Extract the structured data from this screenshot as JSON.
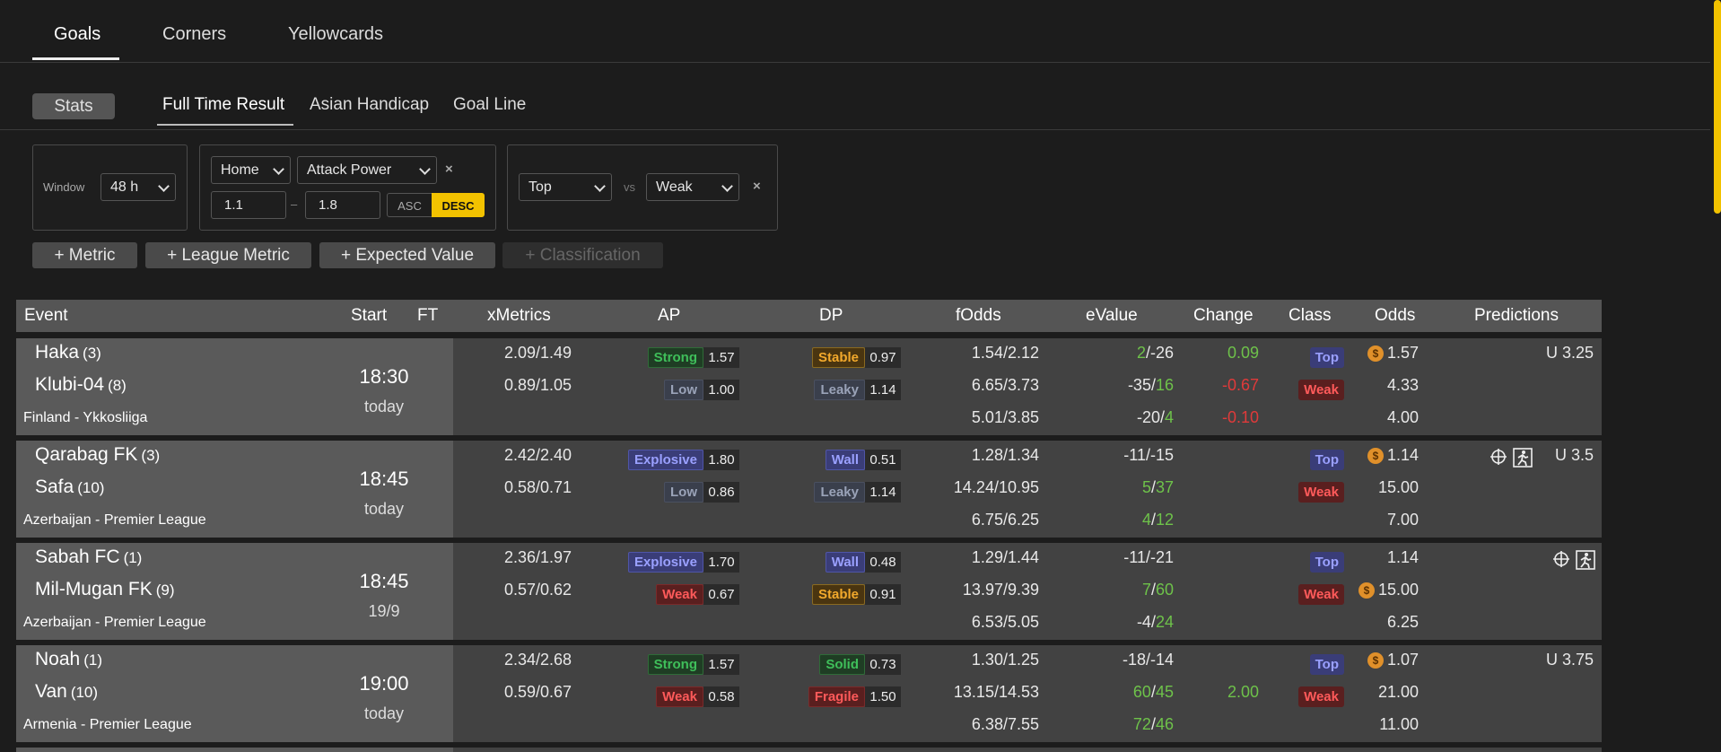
{
  "top_tabs": [
    "Goals",
    "Corners",
    "Yellowcards"
  ],
  "stats_label": "Stats",
  "sub_tabs": [
    "Full Time Result",
    "Asian Handicap",
    "Goal Line"
  ],
  "filters": {
    "window_label": "Window",
    "window_value": "48 h",
    "side_value": "Home",
    "metric_value": "Attack Power",
    "range_min": "1.1",
    "range_max": "1.8",
    "range_sep": "–",
    "asc_label": "ASC",
    "desc_label": "DESC",
    "class_a": "Top",
    "vs_label": "vs",
    "class_b": "Weak",
    "close_glyph": "×"
  },
  "add_buttons": [
    "+ Metric",
    "+ League Metric",
    "+ Expected Value",
    "+ Classification"
  ],
  "columns": [
    "Event",
    "Start",
    "FT",
    "xMetrics",
    "AP",
    "DP",
    "fOdds",
    "eValue",
    "Change",
    "Class",
    "Odds",
    "Predictions"
  ],
  "rows": [
    {
      "home": "Haka",
      "home_rank": "(3)",
      "away": "Klubi-04",
      "away_rank": "(8)",
      "league": "Finland -  Ykkosliiga",
      "time": "18:30",
      "day": "today",
      "xm": [
        "2.09/1.49",
        "0.89/1.05"
      ],
      "ap": [
        {
          "label": "Strong",
          "val": "1.57"
        },
        {
          "label": "Low",
          "val": "1.00"
        }
      ],
      "dp": [
        {
          "label": "Stable",
          "val": "0.97"
        },
        {
          "label": "Leaky",
          "val": "1.14"
        }
      ],
      "fodds": [
        "1.54/2.12",
        "6.65/3.73",
        "5.01/3.85"
      ],
      "evalue": [
        [
          "2",
          "-26"
        ],
        [
          "-35",
          "16"
        ],
        [
          "-20",
          "4"
        ]
      ],
      "change": [
        "0.09",
        "-0.67",
        "-0.10"
      ],
      "odds": [
        "1.57",
        "4.33",
        "4.00"
      ],
      "prediction": "U 3.25"
    },
    {
      "home": "Qarabag FK",
      "home_rank": "(3)",
      "away": "Safa",
      "away_rank": "(10)",
      "league": "Azerbaijan -  Premier League",
      "time": "18:45",
      "day": "today",
      "xm": [
        "2.42/2.40",
        "0.58/0.71"
      ],
      "ap": [
        {
          "label": "Explosive",
          "val": "1.80"
        },
        {
          "label": "Low",
          "val": "0.86"
        }
      ],
      "dp": [
        {
          "label": "Wall",
          "val": "0.51"
        },
        {
          "label": "Leaky",
          "val": "1.14"
        }
      ],
      "fodds": [
        "1.28/1.34",
        "14.24/10.95",
        "6.75/6.25"
      ],
      "evalue": [
        [
          "-11",
          "-15"
        ],
        [
          "5",
          "37"
        ],
        [
          "4",
          "12"
        ]
      ],
      "change": [
        "",
        "",
        ""
      ],
      "odds": [
        "1.14",
        "15.00",
        "7.00"
      ],
      "prediction": "U 3.5"
    },
    {
      "home": "Sabah FC",
      "home_rank": "(1)",
      "away": "Mil-Mugan FK",
      "away_rank": "(9)",
      "league": "Azerbaijan -  Premier League",
      "time": "18:45",
      "day": "19/9",
      "xm": [
        "2.36/1.97",
        "0.57/0.62"
      ],
      "ap": [
        {
          "label": "Explosive",
          "val": "1.70"
        },
        {
          "label": "Weak",
          "val": "0.67"
        }
      ],
      "dp": [
        {
          "label": "Wall",
          "val": "0.48"
        },
        {
          "label": "Stable",
          "val": "0.91"
        }
      ],
      "fodds": [
        "1.29/1.44",
        "13.97/9.39",
        "6.53/5.05"
      ],
      "evalue": [
        [
          "-11",
          "-21"
        ],
        [
          "7",
          "60"
        ],
        [
          "-4",
          "24"
        ]
      ],
      "change": [
        "",
        "",
        ""
      ],
      "odds": [
        "1.14",
        "15.00",
        "6.25"
      ],
      "prediction": ""
    },
    {
      "home": "Noah",
      "home_rank": "(1)",
      "away": "Van",
      "away_rank": "(10)",
      "league": "Armenia -  Premier League",
      "time": "19:00",
      "day": "today",
      "xm": [
        "2.34/2.68",
        "0.59/0.67"
      ],
      "ap": [
        {
          "label": "Strong",
          "val": "1.57"
        },
        {
          "label": "Weak",
          "val": "0.58"
        }
      ],
      "dp": [
        {
          "label": "Solid",
          "val": "0.73"
        },
        {
          "label": "Fragile",
          "val": "1.50"
        }
      ],
      "fodds": [
        "1.30/1.25",
        "13.15/14.53",
        "6.38/7.55"
      ],
      "evalue": [
        [
          "-18",
          "-14"
        ],
        [
          "60",
          "45"
        ],
        [
          "72",
          "46"
        ]
      ],
      "change": [
        "",
        "2.00",
        ""
      ],
      "odds": [
        "1.07",
        "21.00",
        "11.00"
      ],
      "prediction": "U 3.75"
    }
  ],
  "class_labels": [
    "Top",
    "Weak"
  ],
  "money_glyph": "$"
}
